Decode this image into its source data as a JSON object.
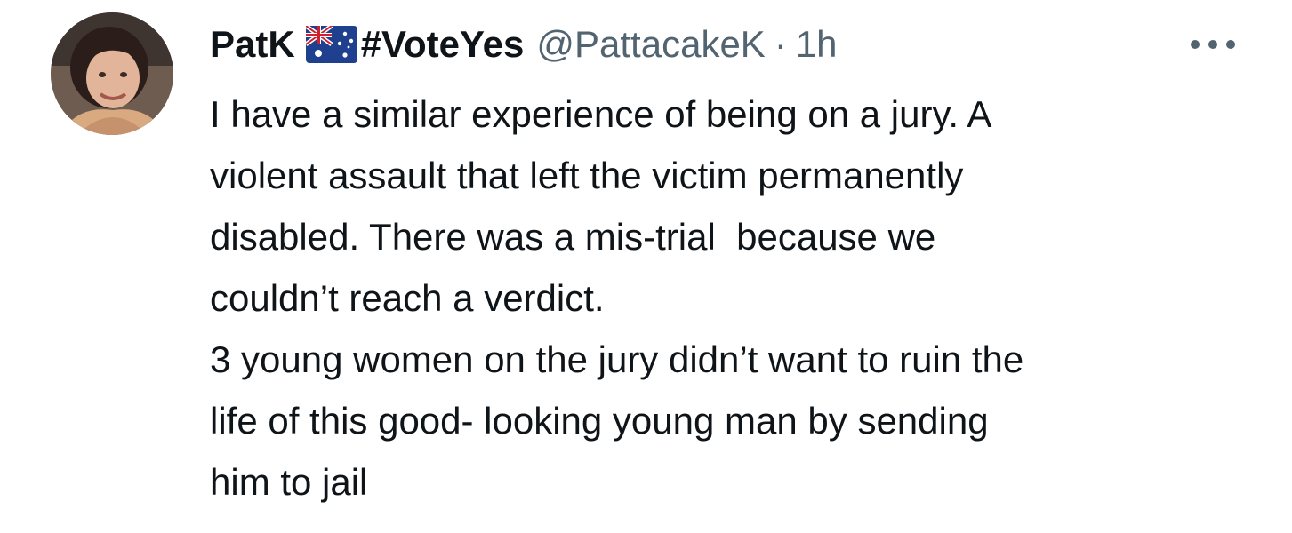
{
  "author": {
    "display_name": "PatK",
    "flag_icon": "australia-flag-icon",
    "hashtag": "#VoteYes",
    "handle": "@PattacakeK",
    "separator": "·",
    "time": "1h"
  },
  "menu": {
    "icon": "more-horizontal-icon"
  },
  "tweet": {
    "lines": [
      "I have a similar experience of being on a jury. A",
      "violent assault that left the victim permanently",
      "disabled. There was a mis-trial  because we",
      "couldn’t reach a verdict.",
      "3 young women on the jury didn’t want to ruin the",
      "life of this good- looking young man by sending",
      "him to jail"
    ]
  },
  "colors": {
    "text": "#0f1419",
    "secondary": "#536471",
    "background": "#ffffff"
  }
}
